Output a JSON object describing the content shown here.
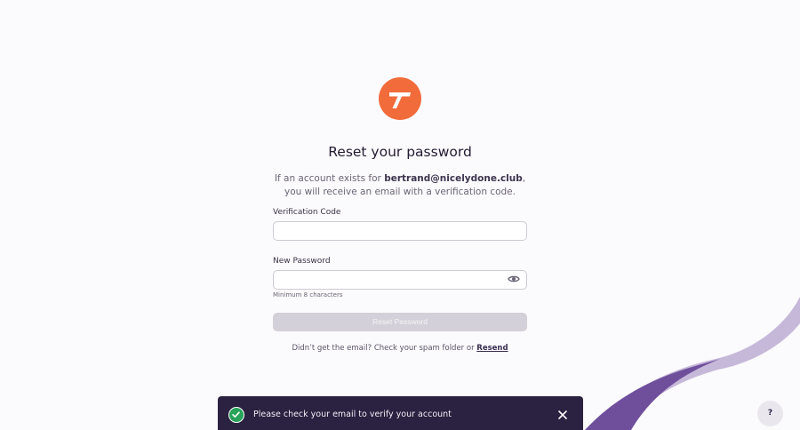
{
  "brand": {
    "logo_icon": "brand-t-logo",
    "accent_color": "#f26b3a"
  },
  "header": {
    "title": "Reset your password",
    "subtitle_prefix": "If an account exists for ",
    "email": "bertrand@nicelydone.club",
    "subtitle_suffix": ", you will receive an email with a verification code."
  },
  "form": {
    "verification_code": {
      "label": "Verification Code",
      "value": "",
      "placeholder": ""
    },
    "new_password": {
      "label": "New Password",
      "value": "",
      "placeholder": "",
      "hint": "Minimum 8 characters",
      "toggle_icon": "eye-icon"
    },
    "submit_label": "Reset Password",
    "submit_disabled": true
  },
  "resend": {
    "text": "Didn’t get the email? Check your spam folder or ",
    "link_label": "Resend"
  },
  "toast": {
    "message": "Please check your email to verify your account",
    "status_icon": "check-circle-icon",
    "close_icon": "close-icon",
    "status_color": "#27a35a"
  },
  "help": {
    "label": "?"
  }
}
